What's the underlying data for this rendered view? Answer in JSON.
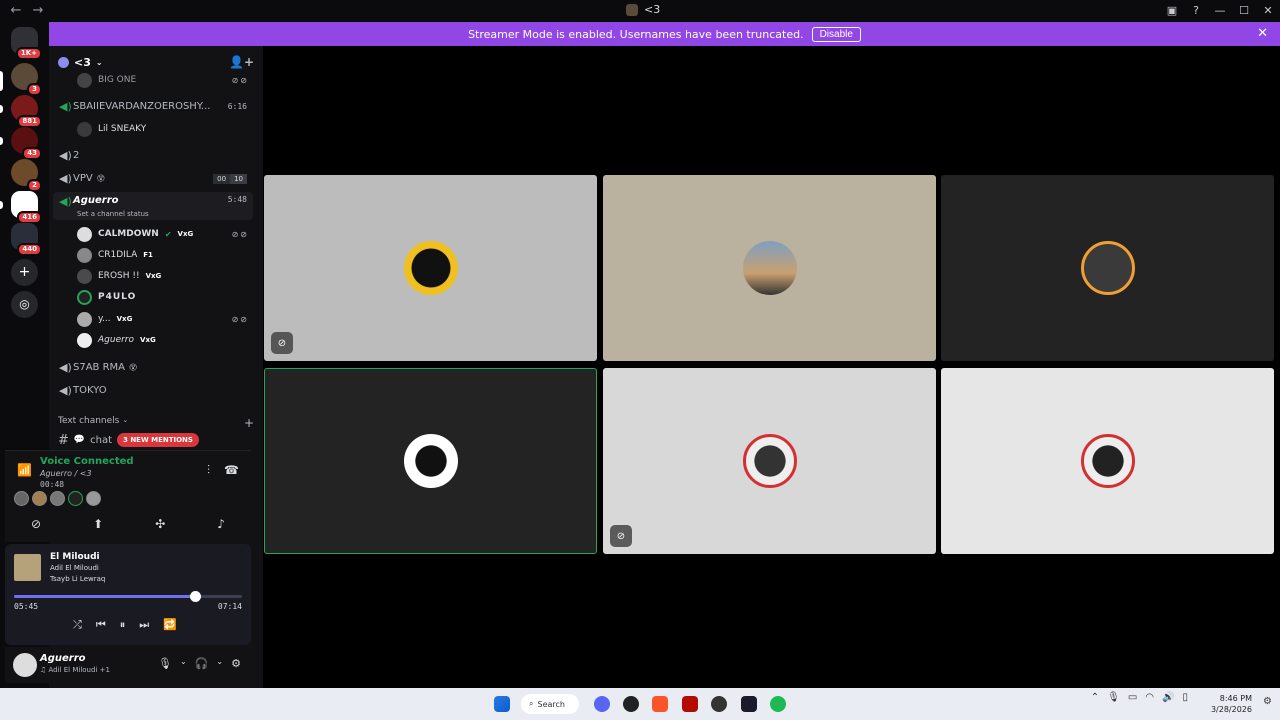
{
  "titlebar": {
    "server_name": "<3"
  },
  "banner": {
    "text": "Streamer Mode is enabled. Usernames have been truncated.",
    "button": "Disable"
  },
  "servers": [
    {
      "name": "discord-home",
      "badge": "1K+"
    },
    {
      "name": "server-1",
      "badge": "3"
    },
    {
      "name": "server-2",
      "badge": "881"
    },
    {
      "name": "server-3",
      "badge": "43"
    },
    {
      "name": "server-4",
      "badge": "2"
    },
    {
      "name": "server-5",
      "badge": "416"
    },
    {
      "name": "server-6",
      "badge": "440"
    }
  ],
  "guild": {
    "name": "<3"
  },
  "channels": {
    "big_one_user": "BIG ONE",
    "sbaiie": {
      "name": "SBAIIEVARDANZOEROSHY...",
      "time": "6:16"
    },
    "lil_sneaky": "Lil SNEAKY",
    "two": {
      "name": "2"
    },
    "vpv": {
      "name": "VPV",
      "limit_a": "00",
      "limit_b": "10"
    },
    "aguerro": {
      "name": "Aguerro",
      "status": "Set a channel status",
      "time": "5:48"
    },
    "members": [
      {
        "name": "CALMDOWN",
        "tag": "VxG"
      },
      {
        "name": "CR1DILA",
        "tag": "F1"
      },
      {
        "name": "EROSH !!",
        "tag": "VxG"
      },
      {
        "name": "P4ULO",
        "tag": ""
      },
      {
        "name": "y...",
        "tag": "VxG"
      },
      {
        "name": "Aguerro",
        "tag": "VxG"
      }
    ],
    "s7ab": {
      "name": "S7AB RMA"
    },
    "tokyo": {
      "name": "TOKYO"
    }
  },
  "text_channels": {
    "header": "Text channels",
    "chat": "chat",
    "mentions": "3 NEW MENTIONS"
  },
  "voice": {
    "title": "Voice Connected",
    "sub": "Aguerro / <3",
    "time": "00:48"
  },
  "music": {
    "title": "El Miloudi",
    "artist": "Adil El Miloudi",
    "album": "Tsayb Li Lewraq",
    "current": "05:45",
    "duration": "07:14",
    "progress": 0.795
  },
  "userbar": {
    "name": "Aguerro",
    "status": "Adil El Miloudi +1"
  },
  "taskbar": {
    "search": "Search",
    "time": "8:46 PM",
    "date": "3/28/2026"
  },
  "colors": {
    "accent": "#9147e6",
    "connected": "#23a55a",
    "mention": "#da373c"
  },
  "tiles": [
    {
      "bg": "#bcbcbc",
      "muted": true,
      "speaking": false
    },
    {
      "bg": "#bbb19f",
      "muted": false,
      "speaking": false
    },
    {
      "bg": "#232323",
      "muted": false,
      "speaking": false
    },
    {
      "bg": "#232323",
      "muted": false,
      "speaking": true
    },
    {
      "bg": "#d8d8d8",
      "muted": true,
      "speaking": false
    },
    {
      "bg": "#e6e6e6",
      "muted": false,
      "speaking": false
    }
  ]
}
